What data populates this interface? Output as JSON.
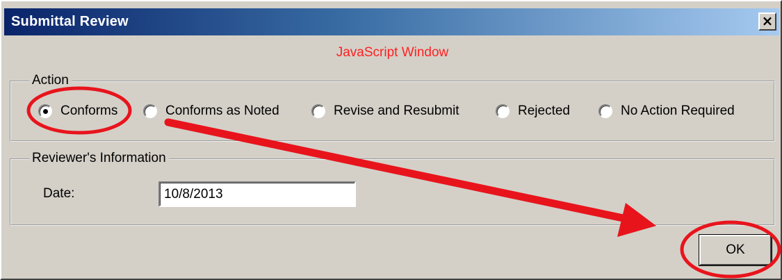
{
  "window": {
    "title": "Submittal Review",
    "close_label": "×",
    "subtitle": "JavaScript Window"
  },
  "action": {
    "legend": "Action",
    "options": [
      {
        "label": "Conforms",
        "checked": true
      },
      {
        "label": "Conforms as Noted",
        "checked": false
      },
      {
        "label": "Revise and Resubmit",
        "checked": false
      },
      {
        "label": "Rejected",
        "checked": false
      },
      {
        "label": "No Action Required",
        "checked": false
      }
    ]
  },
  "reviewer": {
    "legend": "Reviewer's Information",
    "date_label": "Date:",
    "date_value": "10/8/2013"
  },
  "footer": {
    "ok_label": "OK"
  },
  "annotation_color": "#e8141c"
}
